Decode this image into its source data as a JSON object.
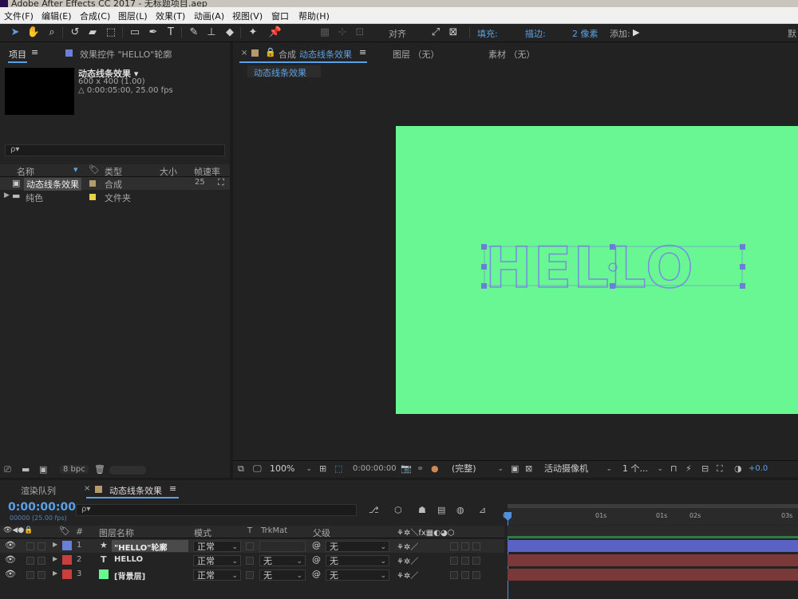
{
  "app_title": "Adobe After Effects CC 2017 - 无标题项目.aep",
  "menu": [
    "文件(F)",
    "编辑(E)",
    "合成(C)",
    "图层(L)",
    "效果(T)",
    "动画(A)",
    "视图(V)",
    "窗口",
    "帮助(H)"
  ],
  "toolbar": {
    "align_label": "对齐",
    "fill_label": "填充:",
    "stroke_label": "描边:",
    "stroke_width": "2 像素",
    "add_label": "添加:",
    "workspace_label": "默"
  },
  "project_panel": {
    "tab_project": "项目",
    "tab_effects": "效果控件 \"HELLO\"轮廓",
    "comp_name": "动态线条效果 ▾",
    "comp_size": "600 x 400 (1.00)",
    "comp_duration": "△ 0:00:05:00, 25.00 fps",
    "search_placeholder": "ρ▾",
    "columns": [
      "名称",
      "类型",
      "大小",
      "帧速率"
    ],
    "items": [
      {
        "name": "动态线条效果",
        "type": "合成",
        "size": "",
        "fps": "25",
        "color": "#b59a6e"
      },
      {
        "name": "纯色",
        "type": "文件夹",
        "size": "",
        "fps": "",
        "color": "#e8d24a"
      }
    ],
    "bpc": "8 bpc"
  },
  "viewer": {
    "tab_comp_prefix": "合成",
    "tab_comp_name": "动态线条效果",
    "tab_layer": "图层 （无）",
    "tab_footage": "素材 （无）",
    "breadcrumb": "动态线条效果",
    "canvas_text": "HELLO",
    "canvas_color": "#69f794",
    "zoom": "100%",
    "timecode": "0:00:00:00",
    "resolution": "(完整)",
    "camera": "活动摄像机",
    "views": "1 个...",
    "exposure": "+0.0"
  },
  "timeline": {
    "tab_render": "渲染队列",
    "tab_comp": "动态线条效果",
    "timecode": "0:00:00:00",
    "timecode_sub": "00000 (25.00 fps)",
    "search_placeholder": "ρ▾",
    "col_num": "#",
    "col_name": "图层名称",
    "col_mode": "模式",
    "col_t": "T",
    "col_trkmat": "TrkMat",
    "col_parent": "父级",
    "ruler": [
      "0s",
      "01s",
      "01s",
      "02s",
      "03s"
    ],
    "layers": [
      {
        "num": "1",
        "icon": "★",
        "name": "\"HELLO\"轮廓",
        "mode": "正常",
        "trkmat": "",
        "parent": "无",
        "color": "#6b7fd9",
        "bar": "#5a63c4"
      },
      {
        "num": "2",
        "icon": "T",
        "name": "HELLO",
        "mode": "正常",
        "trkmat": "无",
        "parent": "无",
        "color": "#c93f3f",
        "bar": "#7a3838"
      },
      {
        "num": "3",
        "icon": "▇",
        "name": "[背景层]",
        "mode": "正常",
        "trkmat": "无",
        "parent": "无",
        "color": "#c93f3f",
        "bar": "#7a3838"
      }
    ]
  }
}
